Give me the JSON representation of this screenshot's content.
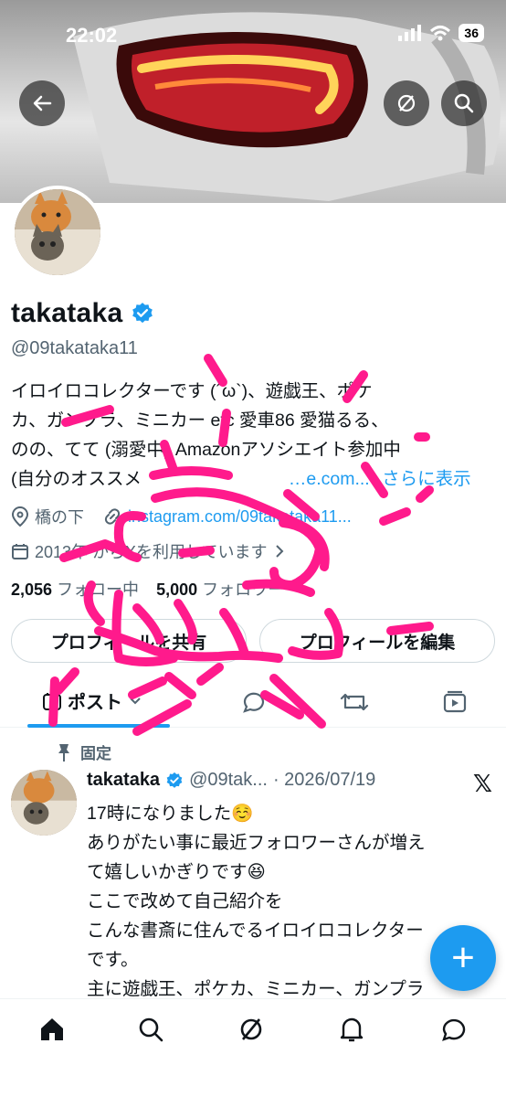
{
  "status": {
    "time": "22:02",
    "battery": "36"
  },
  "profile": {
    "name": "takataka",
    "handle": "@09takataka11",
    "bio": {
      "line1": "イロイロコレクターです (´ω`)、遊戯王、ポケ",
      "line2": "カ、ガンプラ、ミニカー etc 愛車86 愛猫るる、",
      "line3": "のの、てて (溺愛中) Amazonアソシエイト参加中",
      "line4_prefix": "(自分のオススメ",
      "line4_link": "…e.com...",
      "more": "さらに表示"
    },
    "location": "橋の下",
    "website": "instagram.com/09takataka11...",
    "joined": "2013年  からXを利用しています",
    "following_count": "2,056",
    "following_label": "フォロー中",
    "followers_count": "5,000",
    "followers_label": "フォロワー"
  },
  "buttons": {
    "share_profile": "プロフィールを共有",
    "edit_profile": "プロフィールを編集"
  },
  "tabs": {
    "posts": "ポスト"
  },
  "pinned_label": "固定",
  "post": {
    "name": "takataka",
    "handle": "@09tak...",
    "date": "· 2026/07/19",
    "lines": [
      "17時になりました☺️",
      "ありがたい事に最近フォロワーさんが増え",
      "て嬉しいかぎりです😆",
      "ここで改めて自己紹介を",
      "こんな書斎に住んでるイロイロコレクター",
      "です。",
      "主に遊戯王、ポケカ、ミニカー、ガンプラ"
    ]
  },
  "fab": {
    "label": "+"
  },
  "colors": {
    "accent": "#1d9bf0",
    "scribble": "#ff1a8c",
    "text": "#0f1419",
    "muted": "#536471"
  },
  "icons": [
    "back-arrow-icon",
    "grok-icon",
    "search-icon",
    "verified-badge-icon",
    "location-pin-icon",
    "link-icon",
    "calendar-icon",
    "pin-icon",
    "x-logo-icon",
    "home-icon",
    "notifications-icon",
    "messages-icon"
  ]
}
